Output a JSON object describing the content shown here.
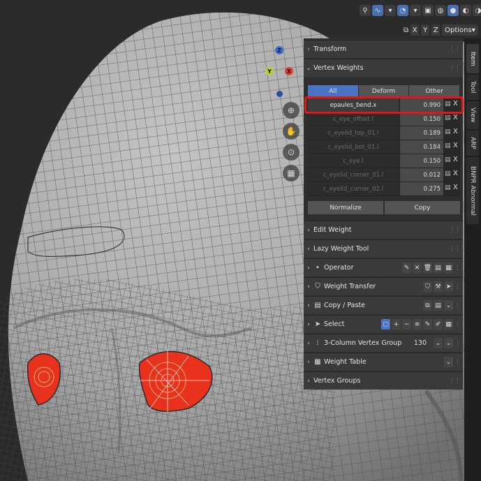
{
  "header": {
    "icons": [
      "pin-icon",
      "snap-icon",
      "overlay-icon",
      "xray-icon",
      "wire-shading-icon",
      "solid-shading-icon",
      "material-shading-icon",
      "render-shading-icon"
    ],
    "mirror_axes": [
      "X",
      "Y",
      "Z"
    ],
    "options_label": "Options"
  },
  "gizmo": {
    "x_label": "X",
    "y_label": "Y",
    "z_label": "Z",
    "x_color": "#e0403a",
    "y_color": "#8ab02a",
    "z_color": "#3b6fd1"
  },
  "panel": {
    "transform_label": "Transform",
    "vertex_weights_label": "Vertex Weights",
    "tabs": [
      "All",
      "Deform",
      "Other"
    ],
    "rows": [
      {
        "name": "epaules_bend.x",
        "value": "0.990"
      },
      {
        "name": "c_eye_offset.l",
        "value": "0.150"
      },
      {
        "name": "c_eyelid_top_01.l",
        "value": "0.189"
      },
      {
        "name": "c_eyelid_bot_01.l",
        "value": "0.184"
      },
      {
        "name": "c_eye.l",
        "value": "0.150"
      },
      {
        "name": "c_eyelid_corner_01.l",
        "value": "0.012"
      },
      {
        "name": "c_eyelid_corner_02.l",
        "value": "0.275"
      }
    ],
    "remove_symbol": "X",
    "normalize_label": "Normalize",
    "copy_label": "Copy",
    "edit_weight_label": "Edit Weight",
    "lazy_weight_tool_label": "Lazy Weight Tool",
    "operator_label": "Operator",
    "weight_transfer_label": "Weight Transfer",
    "copy_paste_label": "Copy / Paste",
    "select_label": "Select",
    "three_col_label": "3-Column Vertex Group",
    "three_col_value": "130",
    "weight_table_label": "Weight Table",
    "vertex_groups_label": "Vertex Groups"
  },
  "right_tabs": [
    "Item",
    "Tool",
    "View",
    "ARP",
    "BNPR Abnormal"
  ],
  "colors": {
    "accent": "#4a73c2",
    "highlight": "#e01818",
    "eye": "#e8321e"
  }
}
